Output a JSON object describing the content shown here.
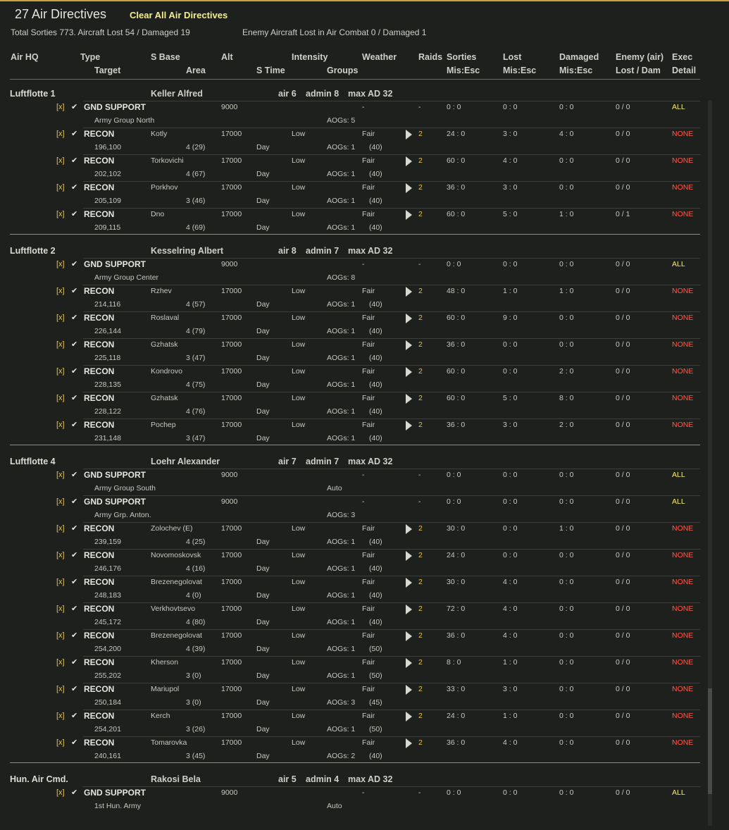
{
  "title": "27 Air Directives",
  "clear_label": "Clear All Air Directives",
  "summary": {
    "left": "Total Sorties 773. Aircraft Lost 54 / Damaged 19",
    "right": "Enemy Aircraft Lost in Air Combat 0 / Damaged 1"
  },
  "headers": {
    "row1": [
      "Air HQ",
      "Type",
      "S Base",
      "Alt",
      "Intensity",
      "Weather",
      "Raids",
      "Sorties",
      "Lost",
      "Damaged",
      "Enemy (air)",
      "Exec"
    ],
    "row2": [
      "Target",
      "Area",
      "S Time",
      "Groups",
      "Mis:Esc",
      "Mis:Esc",
      "Mis:Esc",
      "Lost / Dam",
      "Detail"
    ]
  },
  "icons": {
    "check": "check-icon",
    "execute": "play-triangle-icon"
  },
  "colors": {
    "accent": "#c8a23a",
    "all": "#f0ea7a",
    "none": "#ff5a4a",
    "raids": "#e2c35a"
  },
  "groups": [
    {
      "hq": "Luftflotte 1",
      "commander": "Keller Alfred",
      "air": "air 6",
      "admin": "admin 8",
      "maxad": "max AD 32",
      "rows": [
        {
          "x": "[x]",
          "type": "GND SUPPORT",
          "base": "",
          "alt": "9000",
          "intensity": "",
          "weather": "-",
          "raids": "-",
          "sorties": "0 : 0",
          "lost": "0 : 0",
          "damaged": "0 : 0",
          "enemy": "0 / 0",
          "exec": "ALL",
          "target": "Army Group North",
          "area": "",
          "stime": "",
          "groups": "AOGs: 5",
          "gnum": ""
        },
        {
          "x": "[x]",
          "type": "RECON",
          "base": "Kotly",
          "alt": "17000",
          "intensity": "Low",
          "weather": "Fair",
          "raids": "2",
          "sorties": "24 : 0",
          "lost": "3 : 0",
          "damaged": "4 : 0",
          "enemy": "0 / 0",
          "exec": "NONE",
          "target": "196,100",
          "area": "4 (29)",
          "stime": "Day",
          "groups": "AOGs: 1",
          "gnum": "(40)"
        },
        {
          "x": "[x]",
          "type": "RECON",
          "base": "Torkovichi",
          "alt": "17000",
          "intensity": "Low",
          "weather": "Fair",
          "raids": "2",
          "sorties": "60 : 0",
          "lost": "4 : 0",
          "damaged": "0 : 0",
          "enemy": "0 / 0",
          "exec": "NONE",
          "target": "202,102",
          "area": "4 (67)",
          "stime": "Day",
          "groups": "AOGs: 1",
          "gnum": "(40)"
        },
        {
          "x": "[x]",
          "type": "RECON",
          "base": "Porkhov",
          "alt": "17000",
          "intensity": "Low",
          "weather": "Fair",
          "raids": "2",
          "sorties": "36 : 0",
          "lost": "3 : 0",
          "damaged": "0 : 0",
          "enemy": "0 / 0",
          "exec": "NONE",
          "target": "205,109",
          "area": "3 (46)",
          "stime": "Day",
          "groups": "AOGs: 1",
          "gnum": "(40)"
        },
        {
          "x": "[x]",
          "type": "RECON",
          "base": "Dno",
          "alt": "17000",
          "intensity": "Low",
          "weather": "Fair",
          "raids": "2",
          "sorties": "60 : 0",
          "lost": "5 : 0",
          "damaged": "1 : 0",
          "enemy": "0 / 1",
          "exec": "NONE",
          "target": "209,115",
          "area": "4 (69)",
          "stime": "Day",
          "groups": "AOGs: 1",
          "gnum": "(40)"
        }
      ]
    },
    {
      "hq": "Luftflotte 2",
      "commander": "Kesselring Albert",
      "air": "air 8",
      "admin": "admin 7",
      "maxad": "max AD 32",
      "rows": [
        {
          "x": "[x]",
          "type": "GND SUPPORT",
          "base": "",
          "alt": "9000",
          "intensity": "",
          "weather": "-",
          "raids": "-",
          "sorties": "0 : 0",
          "lost": "0 : 0",
          "damaged": "0 : 0",
          "enemy": "0 / 0",
          "exec": "ALL",
          "target": "Army Group Center",
          "area": "",
          "stime": "",
          "groups": "AOGs: 8",
          "gnum": ""
        },
        {
          "x": "[x]",
          "type": "RECON",
          "base": "Rzhev",
          "alt": "17000",
          "intensity": "Low",
          "weather": "Fair",
          "raids": "2",
          "sorties": "48 : 0",
          "lost": "1 : 0",
          "damaged": "1 : 0",
          "enemy": "0 / 0",
          "exec": "NONE",
          "target": "214,116",
          "area": "4 (57)",
          "stime": "Day",
          "groups": "AOGs: 1",
          "gnum": "(40)"
        },
        {
          "x": "[x]",
          "type": "RECON",
          "base": "Roslaval",
          "alt": "17000",
          "intensity": "Low",
          "weather": "Fair",
          "raids": "2",
          "sorties": "60 : 0",
          "lost": "9 : 0",
          "damaged": "0 : 0",
          "enemy": "0 / 0",
          "exec": "NONE",
          "target": "226,144",
          "area": "4 (79)",
          "stime": "Day",
          "groups": "AOGs: 1",
          "gnum": "(40)"
        },
        {
          "x": "[x]",
          "type": "RECON",
          "base": "Gzhatsk",
          "alt": "17000",
          "intensity": "Low",
          "weather": "Fair",
          "raids": "2",
          "sorties": "36 : 0",
          "lost": "0 : 0",
          "damaged": "0 : 0",
          "enemy": "0 / 0",
          "exec": "NONE",
          "target": "225,118",
          "area": "3 (47)",
          "stime": "Day",
          "groups": "AOGs: 1",
          "gnum": "(40)"
        },
        {
          "x": "[x]",
          "type": "RECON",
          "base": "Kondrovo",
          "alt": "17000",
          "intensity": "Low",
          "weather": "Fair",
          "raids": "2",
          "sorties": "60 : 0",
          "lost": "0 : 0",
          "damaged": "2 : 0",
          "enemy": "0 / 0",
          "exec": "NONE",
          "target": "228,135",
          "area": "4 (75)",
          "stime": "Day",
          "groups": "AOGs: 1",
          "gnum": "(40)"
        },
        {
          "x": "[x]",
          "type": "RECON",
          "base": "Gzhatsk",
          "alt": "17000",
          "intensity": "Low",
          "weather": "Fair",
          "raids": "2",
          "sorties": "60 : 0",
          "lost": "5 : 0",
          "damaged": "8 : 0",
          "enemy": "0 / 0",
          "exec": "NONE",
          "target": "228,122",
          "area": "4 (76)",
          "stime": "Day",
          "groups": "AOGs: 1",
          "gnum": "(40)"
        },
        {
          "x": "[x]",
          "type": "RECON",
          "base": "Pochep",
          "alt": "17000",
          "intensity": "Low",
          "weather": "Fair",
          "raids": "2",
          "sorties": "36 : 0",
          "lost": "3 : 0",
          "damaged": "2 : 0",
          "enemy": "0 / 0",
          "exec": "NONE",
          "target": "231,148",
          "area": "3 (47)",
          "stime": "Day",
          "groups": "AOGs: 1",
          "gnum": "(40)"
        }
      ]
    },
    {
      "hq": "Luftflotte 4",
      "commander": "Loehr Alexander",
      "air": "air 7",
      "admin": "admin 7",
      "maxad": "max AD 32",
      "rows": [
        {
          "x": "[x]",
          "type": "GND SUPPORT",
          "base": "",
          "alt": "9000",
          "intensity": "",
          "weather": "-",
          "raids": "-",
          "sorties": "0 : 0",
          "lost": "0 : 0",
          "damaged": "0 : 0",
          "enemy": "0 / 0",
          "exec": "ALL",
          "target": "Army Group South",
          "area": "",
          "stime": "",
          "groups": "Auto",
          "gnum": ""
        },
        {
          "x": "[x]",
          "type": "GND SUPPORT",
          "base": "",
          "alt": "9000",
          "intensity": "",
          "weather": "-",
          "raids": "-",
          "sorties": "0 : 0",
          "lost": "0 : 0",
          "damaged": "0 : 0",
          "enemy": "0 / 0",
          "exec": "ALL",
          "target": "Army Grp. Anton.",
          "area": "",
          "stime": "",
          "groups": "AOGs: 3",
          "gnum": ""
        },
        {
          "x": "[x]",
          "type": "RECON",
          "base": "Zolochev (E)",
          "alt": "17000",
          "intensity": "Low",
          "weather": "Fair",
          "raids": "2",
          "sorties": "30 : 0",
          "lost": "0 : 0",
          "damaged": "1 : 0",
          "enemy": "0 / 0",
          "exec": "NONE",
          "target": "239,159",
          "area": "4 (25)",
          "stime": "Day",
          "groups": "AOGs: 1",
          "gnum": "(40)"
        },
        {
          "x": "[x]",
          "type": "RECON",
          "base": "Novomoskovsk",
          "alt": "17000",
          "intensity": "Low",
          "weather": "Fair",
          "raids": "2",
          "sorties": "24 : 0",
          "lost": "0 : 0",
          "damaged": "0 : 0",
          "enemy": "0 / 0",
          "exec": "NONE",
          "target": "246,176",
          "area": "4 (16)",
          "stime": "Day",
          "groups": "AOGs: 1",
          "gnum": "(40)"
        },
        {
          "x": "[x]",
          "type": "RECON",
          "base": "Brezenegolovat",
          "alt": "17000",
          "intensity": "Low",
          "weather": "Fair",
          "raids": "2",
          "sorties": "30 : 0",
          "lost": "4 : 0",
          "damaged": "0 : 0",
          "enemy": "0 / 0",
          "exec": "NONE",
          "target": "248,183",
          "area": "4 (0)",
          "stime": "Day",
          "groups": "AOGs: 1",
          "gnum": "(40)"
        },
        {
          "x": "[x]",
          "type": "RECON",
          "base": "Verkhovtsevo",
          "alt": "17000",
          "intensity": "Low",
          "weather": "Fair",
          "raids": "2",
          "sorties": "72 : 0",
          "lost": "4 : 0",
          "damaged": "0 : 0",
          "enemy": "0 / 0",
          "exec": "NONE",
          "target": "245,172",
          "area": "4 (80)",
          "stime": "Day",
          "groups": "AOGs: 1",
          "gnum": "(40)"
        },
        {
          "x": "[x]",
          "type": "RECON",
          "base": "Brezenegolovat",
          "alt": "17000",
          "intensity": "Low",
          "weather": "Fair",
          "raids": "2",
          "sorties": "36 : 0",
          "lost": "4 : 0",
          "damaged": "0 : 0",
          "enemy": "0 / 0",
          "exec": "NONE",
          "target": "254,200",
          "area": "4 (39)",
          "stime": "Day",
          "groups": "AOGs: 1",
          "gnum": "(50)"
        },
        {
          "x": "[x]",
          "type": "RECON",
          "base": "Kherson",
          "alt": "17000",
          "intensity": "Low",
          "weather": "Fair",
          "raids": "2",
          "sorties": "8 : 0",
          "lost": "1 : 0",
          "damaged": "0 : 0",
          "enemy": "0 / 0",
          "exec": "NONE",
          "target": "255,202",
          "area": "3 (0)",
          "stime": "Day",
          "groups": "AOGs: 1",
          "gnum": "(50)"
        },
        {
          "x": "[x]",
          "type": "RECON",
          "base": "Mariupol",
          "alt": "17000",
          "intensity": "Low",
          "weather": "Fair",
          "raids": "2",
          "sorties": "33 : 0",
          "lost": "3 : 0",
          "damaged": "0 : 0",
          "enemy": "0 / 0",
          "exec": "NONE",
          "target": "250,184",
          "area": "3 (0)",
          "stime": "Day",
          "groups": "AOGs: 3",
          "gnum": "(45)"
        },
        {
          "x": "[x]",
          "type": "RECON",
          "base": "Kerch",
          "alt": "17000",
          "intensity": "Low",
          "weather": "Fair",
          "raids": "2",
          "sorties": "24 : 0",
          "lost": "1 : 0",
          "damaged": "0 : 0",
          "enemy": "0 / 0",
          "exec": "NONE",
          "target": "254,201",
          "area": "3 (26)",
          "stime": "Day",
          "groups": "AOGs: 1",
          "gnum": "(50)"
        },
        {
          "x": "[x]",
          "type": "RECON",
          "base": "Tomarovka",
          "alt": "17000",
          "intensity": "Low",
          "weather": "Fair",
          "raids": "2",
          "sorties": "36 : 0",
          "lost": "4 : 0",
          "damaged": "0 : 0",
          "enemy": "0 / 0",
          "exec": "NONE",
          "target": "240,161",
          "area": "3 (45)",
          "stime": "Day",
          "groups": "AOGs: 2",
          "gnum": "(40)"
        }
      ]
    },
    {
      "hq": "Hun. Air Cmd.",
      "commander": "Rakosi Bela",
      "air": "air 5",
      "admin": "admin 4",
      "maxad": "max AD 32",
      "rows": [
        {
          "x": "[x]",
          "type": "GND SUPPORT",
          "base": "",
          "alt": "9000",
          "intensity": "",
          "weather": "-",
          "raids": "-",
          "sorties": "0 : 0",
          "lost": "0 : 0",
          "damaged": "0 : 0",
          "enemy": "0 / 0",
          "exec": "ALL",
          "target": "1st Hun. Army",
          "area": "",
          "stime": "",
          "groups": "Auto",
          "gnum": ""
        }
      ]
    }
  ]
}
